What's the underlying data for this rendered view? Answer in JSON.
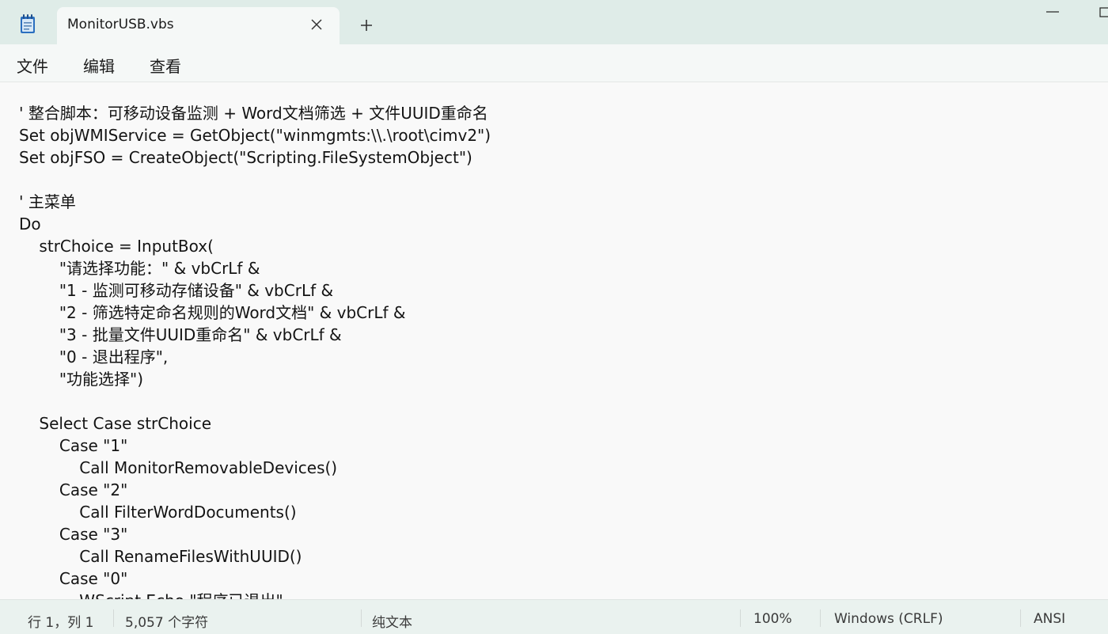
{
  "window": {
    "tab_title": "MonitorUSB.vbs",
    "icons": {
      "app": "notepad-icon",
      "tab_close": "close-icon",
      "new_tab": "plus-icon",
      "minimize": "minimize-icon",
      "maximize": "maximize-icon"
    }
  },
  "menu": {
    "file": "文件",
    "edit": "编辑",
    "view": "查看"
  },
  "editor": {
    "lines": [
      "' 整合脚本：可移动设备监测 + Word文档筛选 + 文件UUID重命名",
      "Set objWMIService = GetObject(\"winmgmts:\\\\.\\root\\cimv2\")",
      "Set objFSO = CreateObject(\"Scripting.FileSystemObject\")",
      "",
      "' 主菜单",
      "Do",
      "    strChoice = InputBox(",
      "        \"请选择功能：\" & vbCrLf &",
      "        \"1 - 监测可移动存储设备\" & vbCrLf &",
      "        \"2 - 筛选特定命名规则的Word文档\" & vbCrLf &",
      "        \"3 - 批量文件UUID重命名\" & vbCrLf &",
      "        \"0 - 退出程序\",",
      "        \"功能选择\")",
      "",
      "    Select Case strChoice",
      "        Case \"1\"",
      "            Call MonitorRemovableDevices()",
      "        Case \"2\"",
      "            Call FilterWordDocuments()",
      "        Case \"3\"",
      "            Call RenameFilesWithUUID()",
      "        Case \"0\"",
      "            WScript.Echo \"程序已退出\""
    ]
  },
  "status": {
    "position": "行 1，列 1",
    "char_count": "5,057 个字符",
    "format": "纯文本",
    "zoom": "100%",
    "line_ending": "Windows (CRLF)",
    "encoding": "ANSI"
  },
  "colors": {
    "titlebar": "#dfece8",
    "tab": "#f5f8f7",
    "editor_bg": "#f9f9f9",
    "statusbar": "#eaf2ef",
    "icon_accent": "#2b6fbf"
  }
}
